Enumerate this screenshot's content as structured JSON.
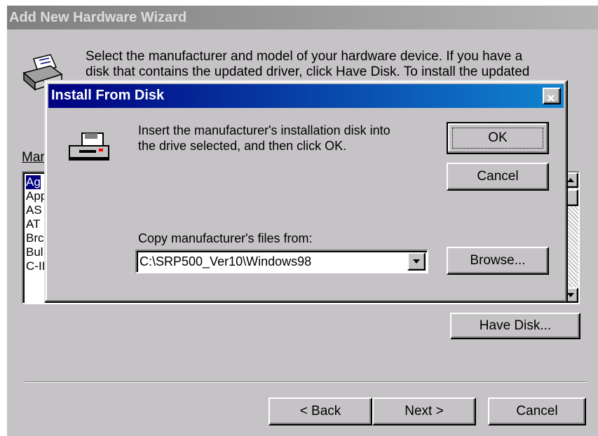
{
  "wizard": {
    "title": "Add New Hardware Wizard",
    "instruction_line1": "Select the manufacturer and model of your hardware device. If you have a",
    "instruction_line2": "disk that contains the updated driver, click Have Disk. To install the updated",
    "manufacturers_label": "Mar",
    "manufacturers": [
      "Ag",
      "App",
      "AS",
      "AT",
      "Brc",
      "Bul",
      "C-II"
    ],
    "have_disk_label": "Have Disk...",
    "back_label": "< Back",
    "next_label": "Next >",
    "cancel_label": "Cancel"
  },
  "dialog": {
    "title": "Install From Disk",
    "close_label": "×",
    "message_line1": "Insert the manufacturer's installation disk into",
    "message_line2": "the drive selected, and then click OK.",
    "ok_label": "OK",
    "cancel_label": "Cancel",
    "copy_label": "Copy manufacturer's files from:",
    "path_value": "C:\\SRP500_Ver10\\Windows98",
    "browse_label": "Browse..."
  },
  "icons": {
    "printer": "printer-icon",
    "disk_drive": "disk-drive-icon",
    "dropdown": "chevron-down-icon",
    "scroll_up": "scroll-up-icon",
    "scroll_down": "scroll-down-icon"
  }
}
